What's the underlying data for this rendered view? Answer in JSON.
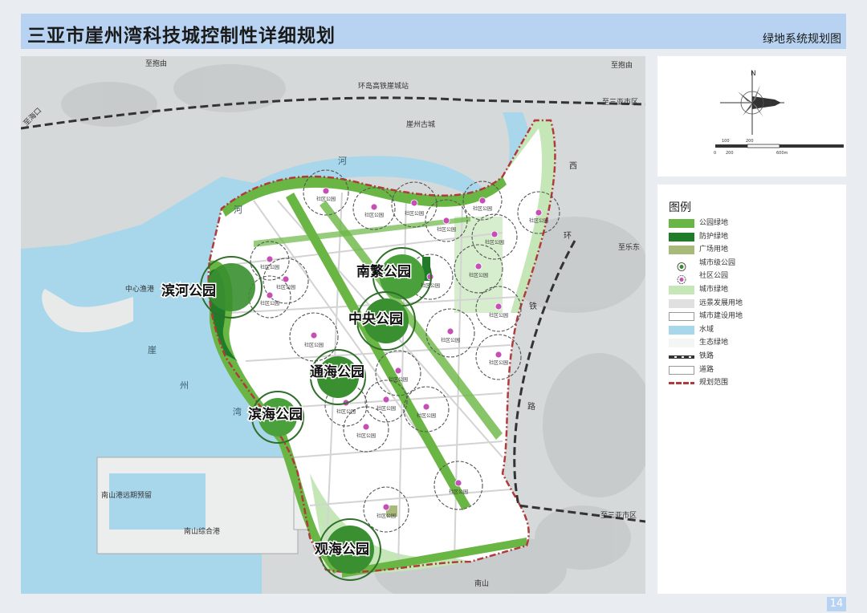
{
  "header": {
    "title": "三亚市崖州湾科技城控制性详细规划",
    "subtitle": "绿地系统规划图"
  },
  "page_number": "14",
  "map": {
    "major_parks": [
      "滨河公园",
      "南繁公园",
      "中央公园",
      "通海公园",
      "滨海公园",
      "观海公园"
    ],
    "place_labels": {
      "zhibaoyou_top": "至抱由",
      "zhibaoyou_right": "至抱由",
      "zhihaikou": "至海口",
      "sanya_top": "至三亚市区",
      "sanya_bottom": "至三亚市区",
      "zhiledong": "至乐东",
      "huandao_rail": "环岛高铁崖城站",
      "yazhou_old": "崖州古城",
      "zhongxin_port": "中心渔港",
      "nanshan_far": "南山港远期预留",
      "nanshan_port": "南山综合港",
      "nanshan": "南山",
      "bay_chars": [
        "崖",
        "州",
        "湾"
      ],
      "river_chars": [
        "河",
        "河"
      ],
      "rail_chars": [
        "西",
        "环",
        "铁",
        "路"
      ]
    },
    "small_labels": [
      "社区公园",
      "社区公园",
      "社区公园",
      "社区公园",
      "社区公园",
      "社区公园",
      "社区公园",
      "社区公园",
      "社区公园",
      "社区公园",
      "社区公园",
      "社区公园",
      "社区公园",
      "社区公园",
      "社区公园",
      "社区公园",
      "社区公园",
      "社区公园",
      "社区公园",
      "社区公园",
      "社区公园",
      "社区公园",
      "社区公园"
    ]
  },
  "compass": {
    "north": "N",
    "scale_top": [
      "100",
      "200"
    ],
    "scale_bottom": [
      "0",
      "200",
      "600m"
    ]
  },
  "legend": {
    "title": "图例",
    "items": [
      {
        "label": "公园绿地",
        "kind": "fill",
        "color": "#6ab644"
      },
      {
        "label": "防护绿地",
        "kind": "fill",
        "color": "#1f7d2a"
      },
      {
        "label": "广场用地",
        "kind": "fill",
        "color": "#a9b97a"
      },
      {
        "label": "城市级公园",
        "kind": "citypark",
        "color": "#2f8f2a"
      },
      {
        "label": "社区公园",
        "kind": "community",
        "color": "#c64fb5"
      },
      {
        "label": "城市绿地",
        "kind": "fill",
        "color": "#c5e7b8"
      },
      {
        "label": "远景发展用地",
        "kind": "fill",
        "color": "#e0e0e0"
      },
      {
        "label": "城市建设用地",
        "kind": "outline",
        "color": "#ffffff"
      },
      {
        "label": "水域",
        "kind": "fill",
        "color": "#a8d7ec"
      },
      {
        "label": "生态绿地",
        "kind": "fill",
        "color": "#f3f6f2"
      },
      {
        "label": "铁路",
        "kind": "rail",
        "color": "#333333"
      },
      {
        "label": "道路",
        "kind": "outline",
        "color": "#ffffff"
      },
      {
        "label": "规划范围",
        "kind": "boundary",
        "color": "#b23a3a"
      }
    ]
  }
}
